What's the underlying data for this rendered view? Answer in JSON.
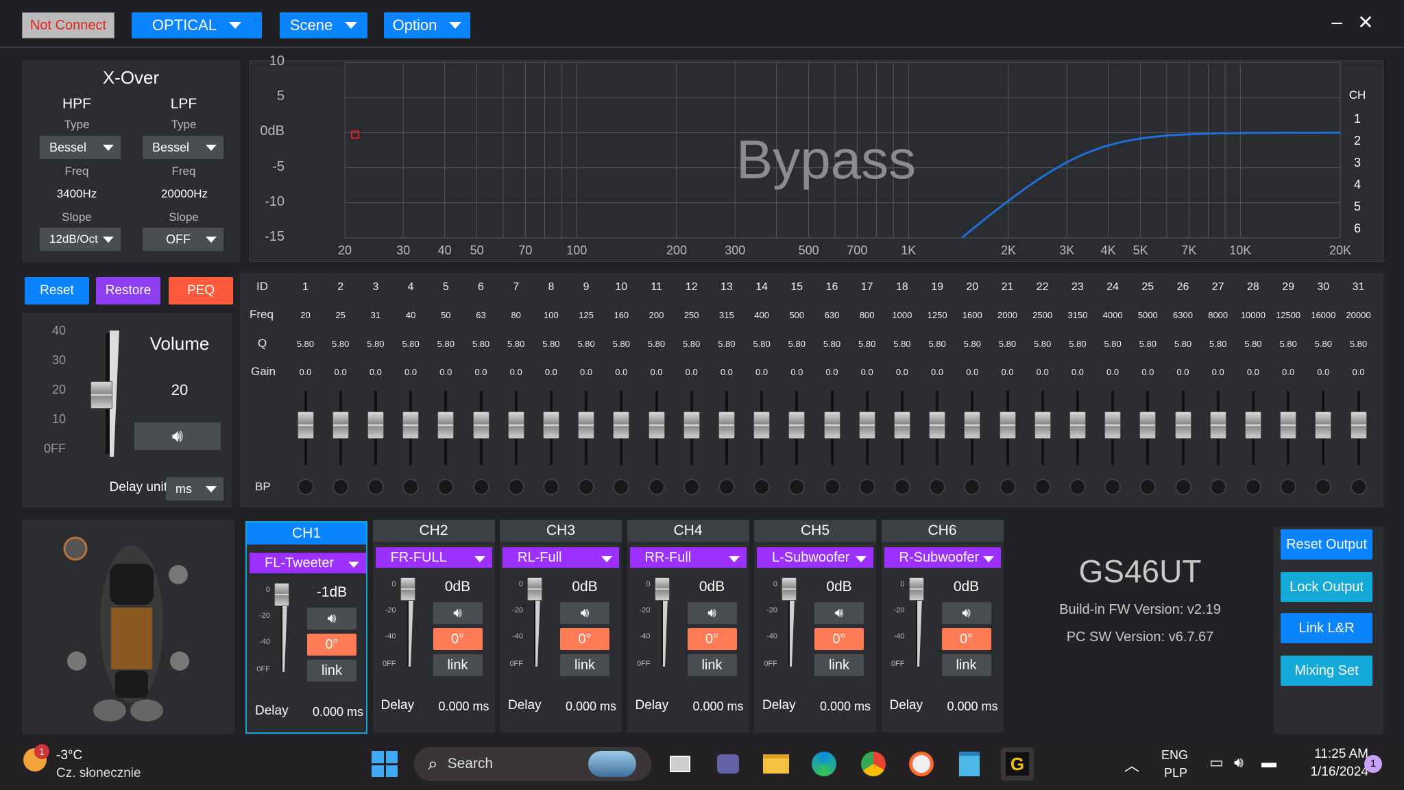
{
  "topbar": {
    "status": "Not Connect",
    "source": "OPTICAL",
    "scene": "Scene",
    "option": "Option",
    "minimize": "–",
    "close": "✕"
  },
  "xover": {
    "title": "X-Over",
    "hpf": {
      "title": "HPF",
      "type_label": "Type",
      "type": "Bessel",
      "freq_label": "Freq",
      "freq": "3400Hz",
      "slope_label": "Slope",
      "slope": "12dB/Oct"
    },
    "lpf": {
      "title": "LPF",
      "type_label": "Type",
      "type": "Bessel",
      "freq_label": "Freq",
      "freq": "20000Hz",
      "slope_label": "Slope",
      "slope": "OFF"
    }
  },
  "graph": {
    "watermark": "Bypass",
    "y_ticks": [
      "10",
      "5",
      "0dB",
      "-5",
      "-10",
      "-15"
    ],
    "x_ticks": [
      "20",
      "30",
      "40",
      "50",
      "70",
      "100",
      "200",
      "300",
      "500",
      "700",
      "1K",
      "2K",
      "3K",
      "4K",
      "5K",
      "7K",
      "10K",
      "20K"
    ],
    "ch_title": "CH",
    "channels": [
      "1",
      "2",
      "3",
      "4",
      "5",
      "6"
    ],
    "curve_color": "#1e6fd9"
  },
  "controls": {
    "reset": "Reset",
    "restore": "Restore",
    "peq": "PEQ"
  },
  "volume": {
    "title": "Volume",
    "value": "20",
    "scale": [
      "40",
      "30",
      "20",
      "10",
      "0FF"
    ],
    "delay_unit_label": "Delay unit",
    "delay_unit": "ms",
    "level": 0.5
  },
  "peq": {
    "id_label": "ID",
    "freq_label": "Freq",
    "q_label": "Q",
    "gain_label": "Gain",
    "bp_label": "BP",
    "ids": [
      "1",
      "2",
      "3",
      "4",
      "5",
      "6",
      "7",
      "8",
      "9",
      "10",
      "11",
      "12",
      "13",
      "14",
      "15",
      "16",
      "17",
      "18",
      "19",
      "20",
      "21",
      "22",
      "23",
      "24",
      "25",
      "26",
      "27",
      "28",
      "29",
      "30",
      "31"
    ],
    "freqs": [
      "20",
      "25",
      "31",
      "40",
      "50",
      "63",
      "80",
      "100",
      "125",
      "160",
      "200",
      "250",
      "315",
      "400",
      "500",
      "630",
      "800",
      "1000",
      "1250",
      "1600",
      "2000",
      "2500",
      "3150",
      "4000",
      "5000",
      "6300",
      "8000",
      "10000",
      "12500",
      "16000",
      "20000"
    ],
    "q": "5.80",
    "gain": "0.0"
  },
  "channels": [
    {
      "name": "CH1",
      "preset": "FL-Tweeter",
      "gain": "-1dB",
      "phase": "0°",
      "link": "link",
      "delay_label": "Delay",
      "delay": "0.000 ms",
      "active": true
    },
    {
      "name": "CH2",
      "preset": "FR-FULL",
      "gain": "0dB",
      "phase": "0°",
      "link": "link",
      "delay_label": "Delay",
      "delay": "0.000 ms"
    },
    {
      "name": "CH3",
      "preset": "RL-Full",
      "gain": "0dB",
      "phase": "0°",
      "link": "link",
      "delay_label": "Delay",
      "delay": "0.000 ms"
    },
    {
      "name": "CH4",
      "preset": "RR-Full",
      "gain": "0dB",
      "phase": "0°",
      "link": "link",
      "delay_label": "Delay",
      "delay": "0.000 ms"
    },
    {
      "name": "CH5",
      "preset": "L-Subwoofer",
      "gain": "0dB",
      "phase": "0°",
      "link": "link",
      "delay_label": "Delay",
      "delay": "0.000 ms"
    },
    {
      "name": "CH6",
      "preset": "R-Subwoofer",
      "gain": "0dB",
      "phase": "0°",
      "link": "link",
      "delay_label": "Delay",
      "delay": "0.000 ms"
    }
  ],
  "ch_scale": [
    "0",
    "-20",
    "-40",
    "0FF"
  ],
  "device": {
    "model": "GS46UT",
    "fw": "Build-in FW Version: v2.19",
    "pc": "PC SW Version: v6.7.67"
  },
  "right_buttons": {
    "reset_output": "Reset Output",
    "lock_output": "Lock Output",
    "link_lr": "Link L&R",
    "mixing_set": "Mixing Set"
  },
  "taskbar": {
    "temp": "-3°C",
    "weather": "Cz. słonecznie",
    "weather_badge": "1",
    "search": "Search",
    "lang1": "ENG",
    "lang2": "PLP",
    "time": "11:25 AM",
    "date": "1/16/2024",
    "notif": "1"
  }
}
